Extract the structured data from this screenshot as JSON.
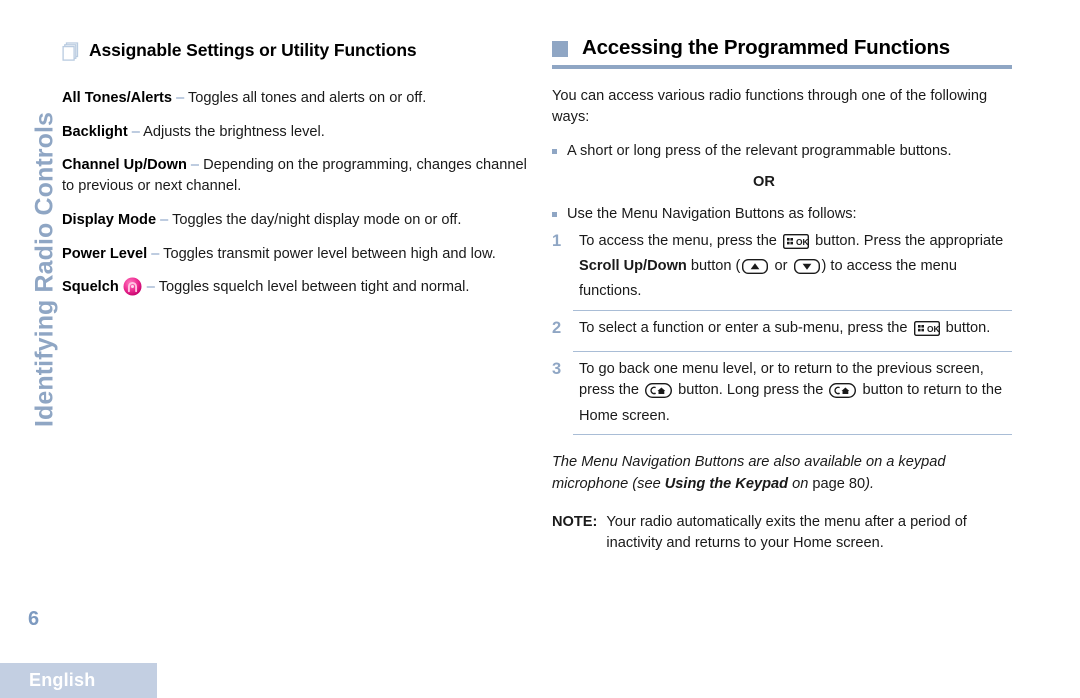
{
  "sidebar": {
    "chapter_tab": "Identifying Radio Controls",
    "page_number": "6",
    "language_banner": "English"
  },
  "left_column": {
    "heading": "Assignable Settings or Utility Functions",
    "heading_icon": "stacked-pages-icon",
    "entries": [
      {
        "term": "All Tones/Alerts",
        "dash": "–",
        "description": "Toggles all tones and alerts on or off.",
        "icon": null
      },
      {
        "term": "Backlight",
        "dash": "–",
        "description": "Adjusts the brightness level.",
        "icon": null
      },
      {
        "term": "Channel Up/Down",
        "dash": "–",
        "description": "Depending on the programming, changes channel to previous or next channel.",
        "icon": null
      },
      {
        "term": "Display Mode",
        "dash": "–",
        "description": "Toggles the day/night display mode on or off.",
        "icon": null
      },
      {
        "term": "Power Level",
        "dash": "–",
        "description": "Toggles transmit power level between high and low.",
        "icon": null
      },
      {
        "term": "Squelch",
        "dash": "–",
        "description": "Toggles squelch level between tight and normal.",
        "icon": "squelch-pink-circle-icon"
      }
    ]
  },
  "right_column": {
    "heading": "Accessing the Programmed Functions",
    "heading_marker": "blue-square-marker",
    "intro": "You can access various radio functions through one of the following ways:",
    "bullet_1": "A short or long press of the relevant programmable buttons.",
    "or_label": "OR",
    "bullet_2": "Use the Menu Navigation Buttons as follows:",
    "steps": [
      {
        "number": "1",
        "text_part_1": "To access the menu, press the",
        "icon_1": "menu-ok-button-icon",
        "text_part_2": "button. Press the appropriate",
        "bold_term": "Scroll Up/Down",
        "text_part_3": "button (",
        "icon_2": "scroll-up-button-icon",
        "text_part_4": "or",
        "icon_3": "scroll-down-button-icon",
        "text_part_5": ") to access the menu functions."
      },
      {
        "number": "2",
        "text_part_1": "To select a function or enter a sub-menu, press the",
        "icon_1": "menu-ok-button-icon",
        "text_part_2": "button."
      },
      {
        "number": "3",
        "text_part_1": "To go back one menu level, or to return to the previous screen, press the",
        "icon_1": "back-home-button-icon",
        "text_part_2": "button. Long press the",
        "icon_2": "back-home-button-icon",
        "text_part_3": "button to return to the Home screen."
      }
    ],
    "keypad_note": {
      "part_1": "The Menu Navigation Buttons are also available on a keypad microphone (see ",
      "bold_ref": "Using the Keypad",
      "part_2": " on ",
      "page_ref": "page 80",
      "part_3": ")."
    },
    "note": {
      "label": "NOTE:",
      "text": "Your radio automatically exits the menu after a period of inactivity and returns to your Home screen."
    }
  },
  "colors": {
    "accent_blue": "#8fa6c4",
    "tab_blue": "#8fa6c4",
    "banner_blue": "#c3cfe2",
    "squelch_pink": "#e62a8b",
    "text_black": "#1a1a1a"
  }
}
